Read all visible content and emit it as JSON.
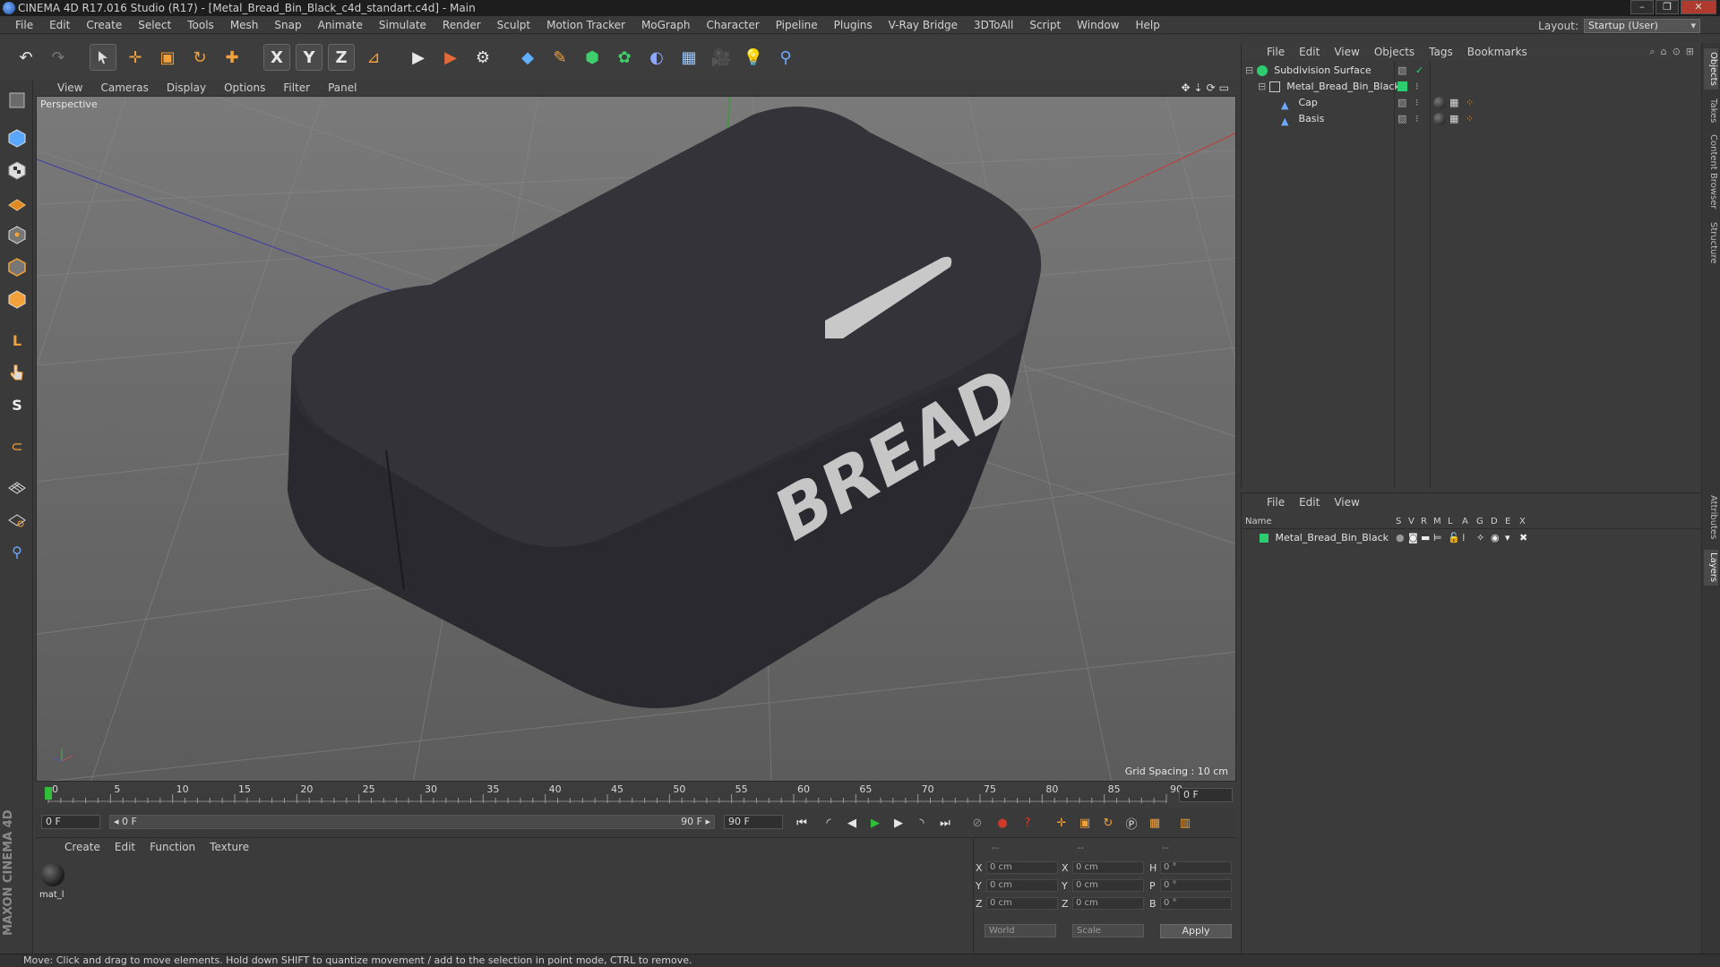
{
  "window": {
    "title": "CINEMA 4D R17.016 Studio (R17) - [Metal_Bread_Bin_Black_c4d_standart.c4d] - Main",
    "minimize": "–",
    "maximize": "❐",
    "close": "✕"
  },
  "menu": [
    "File",
    "Edit",
    "Create",
    "Select",
    "Tools",
    "Mesh",
    "Snap",
    "Animate",
    "Simulate",
    "Render",
    "Sculpt",
    "Motion Tracker",
    "MoGraph",
    "Character",
    "Pipeline",
    "Plugins",
    "V-Ray Bridge",
    "3DToAll",
    "Script",
    "Window",
    "Help"
  ],
  "layout": {
    "label": "Layout:",
    "value": "Startup (User)"
  },
  "toolbar": {
    "undo": "↶",
    "redo": "↷",
    "move": "✛",
    "scale": "▣",
    "rotate": "↻",
    "create": "✚",
    "x": "X",
    "y": "Y",
    "z": "Z",
    "coord": "⊿",
    "render_view": "▶",
    "render_pic": "▶",
    "render_settings": "⚙",
    "cube": "◆",
    "pen": "✎",
    "subdiv": "⬢",
    "array": "✿",
    "deform": "◐",
    "floor": "▦",
    "camera": "🎥",
    "light": "💡",
    "python": "⚲"
  },
  "viewport": {
    "menu": [
      "View",
      "Cameras",
      "Display",
      "Options",
      "Filter",
      "Panel"
    ],
    "label": "Perspective",
    "grid_spacing": "Grid Spacing : 10 cm",
    "model_text": "BREAD"
  },
  "timeline": {
    "ticks": [
      "0",
      "5",
      "10",
      "15",
      "20",
      "25",
      "30",
      "35",
      "40",
      "45",
      "50",
      "55",
      "60",
      "65",
      "70",
      "75",
      "80",
      "85",
      "90"
    ],
    "current_frame_field": "0 F",
    "start_field": "0 F",
    "range_start": "◂ 0 F",
    "range_end": "90 F ▸",
    "end_field": "90 F"
  },
  "material_panel": {
    "menu": [
      "Create",
      "Edit",
      "Function",
      "Texture"
    ],
    "material": "mat_l"
  },
  "coord_panel": {
    "headers": [
      "--",
      "--",
      "--"
    ],
    "rows": [
      {
        "a1": "X",
        "v1": "0 cm",
        "a2": "X",
        "v2": "0 cm",
        "a3": "H",
        "v3": "0 °"
      },
      {
        "a1": "Y",
        "v1": "0 cm",
        "a2": "Y",
        "v2": "0 cm",
        "a3": "P",
        "v3": "0 °"
      },
      {
        "a1": "Z",
        "v1": "0 cm",
        "a2": "Z",
        "v2": "0 cm",
        "a3": "B",
        "v3": "0 °"
      }
    ],
    "mode": "World",
    "transform": "Scale",
    "apply": "Apply"
  },
  "objects_panel": {
    "menu": [
      "File",
      "Edit",
      "View",
      "Objects",
      "Tags",
      "Bookmarks"
    ],
    "items": [
      {
        "name": "Subdivision Surface",
        "indent": 0
      },
      {
        "name": "Metal_Bread_Bin_Black",
        "indent": 1
      },
      {
        "name": "Cap",
        "indent": 2
      },
      {
        "name": "Basis",
        "indent": 2
      }
    ]
  },
  "layers_panel": {
    "menu": [
      "File",
      "Edit",
      "View"
    ],
    "columns": [
      "Name",
      "S",
      "V",
      "R",
      "M",
      "L",
      "A",
      "G",
      "D",
      "E",
      "X"
    ],
    "rows": [
      {
        "name": "Metal_Bread_Bin_Black"
      }
    ]
  },
  "right_tabs": [
    "Objects",
    "Takes",
    "Content Browser",
    "Structure",
    "Attributes",
    "Layers"
  ],
  "brand": "MAXON CINEMA 4D",
  "status": "Move: Click and drag to move elements. Hold down SHIFT to quantize movement / add to the selection in point mode, CTRL to remove.",
  "colors": {
    "accent": "#3a8bd8",
    "layer_green": "#2ecc71",
    "play_green": "#2fbf3a",
    "record_red": "#d03a2a"
  }
}
